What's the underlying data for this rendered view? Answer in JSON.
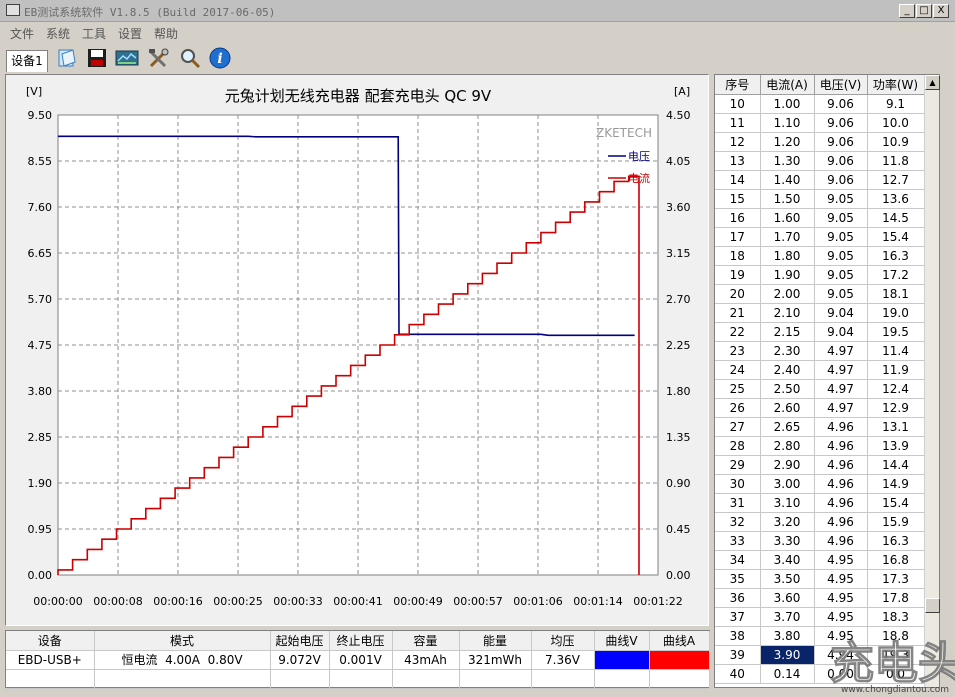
{
  "window": {
    "title": "EB测试系统软件 V1.8.5 (Build 2017-06-05)",
    "minimize": "_",
    "maximize": "□",
    "close": "X"
  },
  "menu": [
    "文件",
    "系统",
    "工具",
    "设置",
    "帮助"
  ],
  "toolbar": {
    "tab_label": "设备1",
    "buttons": [
      "open-icon",
      "save-icon",
      "monitor-icon",
      "tools-icon",
      "search-icon",
      "info-icon"
    ]
  },
  "chart_data": {
    "type": "line",
    "title": "元兔计划无线充电器 配套充电头 QC 9V",
    "left_unit": "[V]",
    "right_unit": "[A]",
    "brand": "ZKETECH",
    "left_ylim": [
      0,
      9.5
    ],
    "right_ylim": [
      0,
      4.5
    ],
    "left_ticks": [
      "9.50",
      "8.55",
      "7.60",
      "6.65",
      "5.70",
      "4.75",
      "3.80",
      "2.85",
      "1.90",
      "0.95",
      "0.00"
    ],
    "right_ticks": [
      "4.50",
      "4.05",
      "3.60",
      "3.15",
      "2.70",
      "2.25",
      "1.80",
      "1.35",
      "0.90",
      "0.45",
      "0.00"
    ],
    "x_ticks": [
      "00:00:00",
      "00:00:08",
      "00:00:16",
      "00:00:25",
      "00:00:33",
      "00:00:41",
      "00:00:49",
      "00:00:57",
      "00:01:06",
      "00:01:14",
      "00:01:22"
    ],
    "xlim": [
      0,
      82
    ],
    "grid": true,
    "legend_position": "top-right",
    "series": [
      {
        "name": "电压",
        "axis": "left",
        "color": "#000080",
        "points": [
          [
            0,
            9.06
          ],
          [
            26,
            9.06
          ],
          [
            27,
            9.05
          ],
          [
            46.5,
            9.05
          ],
          [
            46.6,
            4.97
          ],
          [
            66,
            4.97
          ],
          [
            67,
            4.95
          ],
          [
            78.8,
            4.95
          ]
        ]
      },
      {
        "name": "电流",
        "axis": "right",
        "color": "#cc0000",
        "step_start": 0,
        "step_width": 2.0,
        "step_levels": [
          0.05,
          0.15,
          0.25,
          0.35,
          0.45,
          0.55,
          0.65,
          0.75,
          0.85,
          0.95,
          1.05,
          1.15,
          1.25,
          1.35,
          1.45,
          1.55,
          1.65,
          1.75,
          1.85,
          1.95,
          2.05,
          2.15,
          2.25,
          2.35,
          2.45,
          2.55,
          2.65,
          2.75,
          2.85,
          2.95,
          3.05,
          3.15,
          3.25,
          3.35,
          3.45,
          3.55,
          3.65,
          3.75,
          3.85,
          3.9
        ],
        "end_x": 79.4,
        "end_value": 0.0
      }
    ]
  },
  "table": {
    "headers": [
      "序号",
      "电流(A)",
      "电压(V)",
      "功率(W)"
    ],
    "selected_row": 39,
    "rows": [
      [
        "10",
        "1.00",
        "9.06",
        "9.1"
      ],
      [
        "11",
        "1.10",
        "9.06",
        "10.0"
      ],
      [
        "12",
        "1.20",
        "9.06",
        "10.9"
      ],
      [
        "13",
        "1.30",
        "9.06",
        "11.8"
      ],
      [
        "14",
        "1.40",
        "9.06",
        "12.7"
      ],
      [
        "15",
        "1.50",
        "9.05",
        "13.6"
      ],
      [
        "16",
        "1.60",
        "9.05",
        "14.5"
      ],
      [
        "17",
        "1.70",
        "9.05",
        "15.4"
      ],
      [
        "18",
        "1.80",
        "9.05",
        "16.3"
      ],
      [
        "19",
        "1.90",
        "9.05",
        "17.2"
      ],
      [
        "20",
        "2.00",
        "9.05",
        "18.1"
      ],
      [
        "21",
        "2.10",
        "9.04",
        "19.0"
      ],
      [
        "22",
        "2.15",
        "9.04",
        "19.5"
      ],
      [
        "23",
        "2.30",
        "4.97",
        "11.4"
      ],
      [
        "24",
        "2.40",
        "4.97",
        "11.9"
      ],
      [
        "25",
        "2.50",
        "4.97",
        "12.4"
      ],
      [
        "26",
        "2.60",
        "4.97",
        "12.9"
      ],
      [
        "27",
        "2.65",
        "4.96",
        "13.1"
      ],
      [
        "28",
        "2.80",
        "4.96",
        "13.9"
      ],
      [
        "29",
        "2.90",
        "4.96",
        "14.4"
      ],
      [
        "30",
        "3.00",
        "4.96",
        "14.9"
      ],
      [
        "31",
        "3.10",
        "4.96",
        "15.4"
      ],
      [
        "32",
        "3.20",
        "4.96",
        "15.9"
      ],
      [
        "33",
        "3.30",
        "4.96",
        "16.3"
      ],
      [
        "34",
        "3.40",
        "4.95",
        "16.8"
      ],
      [
        "35",
        "3.50",
        "4.95",
        "17.3"
      ],
      [
        "36",
        "3.60",
        "4.95",
        "17.8"
      ],
      [
        "37",
        "3.70",
        "4.95",
        "18.3"
      ],
      [
        "38",
        "3.80",
        "4.95",
        "18.8"
      ],
      [
        "39",
        "3.90",
        "4.94",
        "19.3"
      ],
      [
        "40",
        "0.14",
        "0.00",
        "0.0"
      ]
    ]
  },
  "summary": {
    "headers": [
      "设备",
      "模式",
      "起始电压",
      "终止电压",
      "容量",
      "能量",
      "均压",
      "曲线V",
      "曲线A"
    ],
    "row": [
      "EBD-USB+",
      "恒电流  4.00A  0.80V",
      "9.072V",
      "0.001V",
      "43mAh",
      "321mWh",
      "7.36V"
    ],
    "curve_colors": {
      "voltage": "#0000ff",
      "current": "#ff0000"
    }
  },
  "watermark": {
    "logo_text": "充电头",
    "url": "www.chongdiantou.com"
  }
}
